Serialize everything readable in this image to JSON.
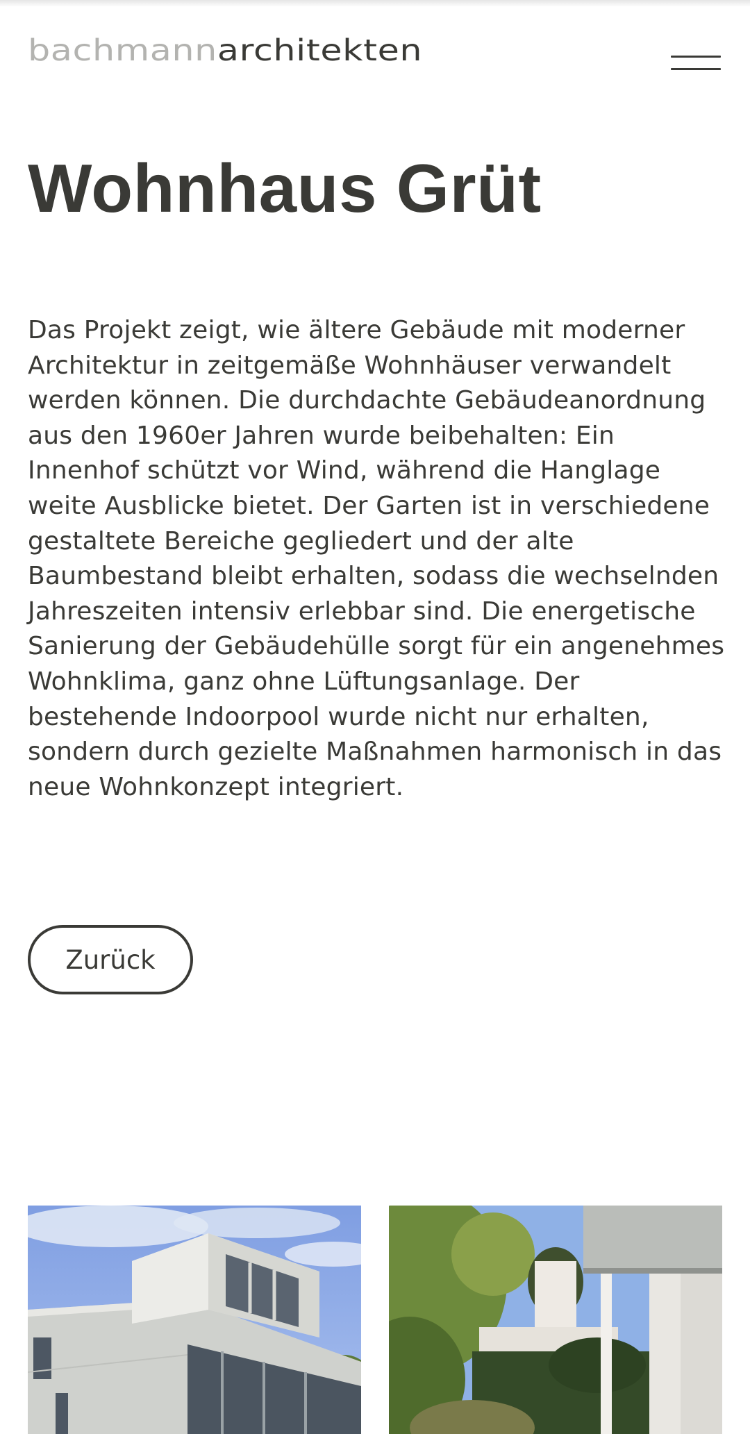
{
  "header": {
    "logo": {
      "part1": "bachmann",
      "part2": "architekten"
    },
    "menu_icon": "hamburger-menu-icon"
  },
  "project": {
    "title": "Wohnhaus Grüt",
    "description": "Das Projekt zeigt, wie ältere Gebäude mit moderner Architektur in zeitgemäße Wohnhäuser verwandelt werden können. Die durchdachte Gebäudeanordnung aus den 1960er Jahren wurde beibehalten: Ein Innenhof schützt vor Wind, während die Hanglage weite Ausblicke bietet. Der Garten ist in verschiedene gestaltete Bereiche gegliedert und der alte Baumbestand bleibt erhalten, sodass die wechselnden Jahreszeiten intensiv erlebbar sind. Die energetische Sanierung der Gebäudehülle sorgt für ein angenehmes Wohnklima, ganz ohne Lüftungsanlage. Der bestehende Indoorpool wurde nicht nur erhalten, sondern durch gezielte Maßnahmen harmonisch in das neue Wohnkonzept integriert.",
    "back_label": "Zurück"
  },
  "colors": {
    "text": "#3a3a36",
    "logo_light": "#b3b3b0",
    "background": "#ffffff"
  }
}
